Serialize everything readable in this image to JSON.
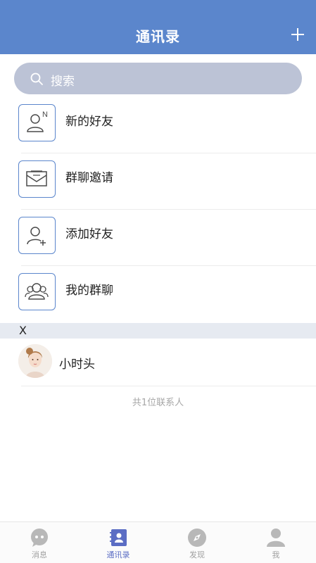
{
  "header": {
    "title": "通讯录",
    "add_icon": "plus-icon"
  },
  "search": {
    "placeholder": "搜索",
    "icon": "search-icon"
  },
  "menu": [
    {
      "label": "新的好友",
      "icon": "new-friend-icon"
    },
    {
      "label": "群聊邀请",
      "icon": "mail-icon"
    },
    {
      "label": "添加好友",
      "icon": "add-friend-icon"
    },
    {
      "label": "我的群聊",
      "icon": "group-icon"
    }
  ],
  "section": {
    "letter": "X"
  },
  "contacts": [
    {
      "name": "小时头",
      "avatar": "avatar-image"
    }
  ],
  "contact_count": "共1位联系人",
  "tabbar": {
    "items": [
      {
        "label": "消息",
        "icon": "chat-icon",
        "active": false
      },
      {
        "label": "通讯录",
        "icon": "contacts-icon",
        "active": true
      },
      {
        "label": "发现",
        "icon": "compass-icon",
        "active": false
      },
      {
        "label": "我",
        "icon": "profile-icon",
        "active": false
      }
    ]
  },
  "colors": {
    "accent": "#5b86cc",
    "search_bg": "#bcc3d6",
    "section_bg": "#e6eaf1",
    "tab_active": "#5b6dc4"
  }
}
